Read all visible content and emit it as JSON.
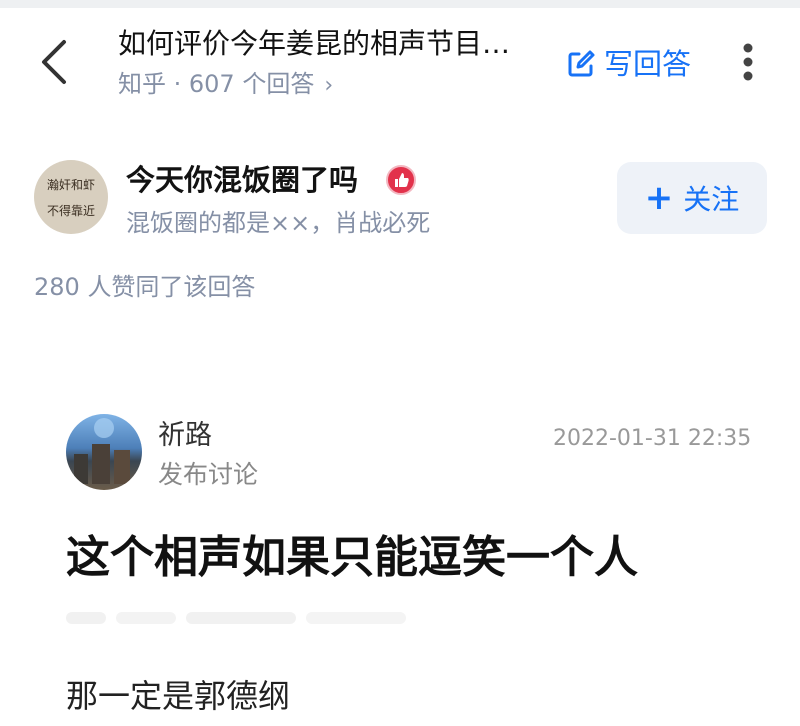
{
  "header": {
    "question_title": "如何评价今年姜昆的相声节目…",
    "source": "知乎",
    "answer_count": "607 个回答",
    "write_answer_label": "写回答"
  },
  "author": {
    "avatar_text_line1": "瀚奸和虾",
    "avatar_text_line2": "不得靠近",
    "name": "今天你混饭圈了吗",
    "bio": "混饭圈的都是××，肖战必死",
    "follow_label": "关注"
  },
  "votes_text": "280 人赞同了该回答",
  "post": {
    "author": "祈路",
    "type": "发布讨论",
    "timestamp": "2022-01-31 22:35",
    "headline": "这个相声如果只能逗笑一个人",
    "body": "那一定是郭德纲"
  },
  "colors": {
    "accent": "#1772f6",
    "muted": "#8590a6",
    "badge": "#e2324b"
  },
  "icons": [
    "back-arrow-icon",
    "chevron-right-icon",
    "edit-icon",
    "more-vertical-icon",
    "plus-icon",
    "thumb-badge-icon"
  ]
}
